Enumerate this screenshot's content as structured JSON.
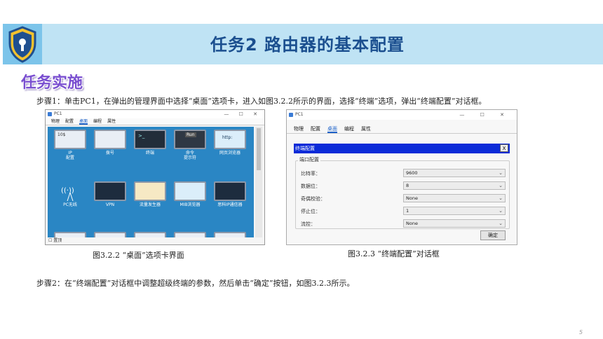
{
  "header": {
    "title": "任务2 路由器的基本配置"
  },
  "section": {
    "title": "任务实施"
  },
  "step1": "步骤1：单击PC1，在弹出的管理界面中选择“桌面”选项卡，进入如图3.2.2所示的界面，选择“终端”选项，弹出“终端配置”对话框。",
  "step2": "步骤2：在“终端配置”对话框中调整超级终端的参数，然后单击“确定”按钮，如图3.2.3所示。",
  "captions": {
    "fig1": "图3.2.2 “桌面”选项卡界面",
    "fig2": "图3.2.3 “终端配置”对话框"
  },
  "page_number": "5",
  "shot1": {
    "window_title": "PC1",
    "controls": "—  ☐  ✕",
    "tabs": [
      "物理",
      "配置",
      "桌面",
      "编程",
      "属性"
    ],
    "icons": [
      {
        "label": "IP\n配置",
        "badge": "10$"
      },
      {
        "label": "拨号",
        "badge": ""
      },
      {
        "label": "终端",
        "badge": ">_"
      },
      {
        "label": "命令\n提示符",
        "badge": "Run"
      },
      {
        "label": "网页浏览器",
        "badge": "http:"
      },
      {
        "label": "PC无线",
        "badge": ""
      },
      {
        "label": "VPN",
        "badge": ""
      },
      {
        "label": "流量发生器",
        "badge": ""
      },
      {
        "label": "MIB浏览器",
        "badge": ""
      },
      {
        "label": "思科IP通信器",
        "badge": ""
      }
    ],
    "checkbox_label": "置顶"
  },
  "shot2": {
    "window_title": "PC1",
    "controls": "—  ☐  ✕",
    "tabs": [
      "物理",
      "配置",
      "桌面",
      "编程",
      "属性"
    ],
    "dialog_title": "终端配置",
    "close": "X",
    "group_label": "端口配置",
    "fields": [
      {
        "label": "比特率：",
        "value": "9600"
      },
      {
        "label": "数据位：",
        "value": "8"
      },
      {
        "label": "奇偶校验：",
        "value": "None"
      },
      {
        "label": "停止位：",
        "value": "1"
      },
      {
        "label": "流控：",
        "value": "None"
      }
    ],
    "ok_label": "确定"
  },
  "colors": {
    "header_band": "#bfe3f4",
    "title_text": "#1b4f8f",
    "section_title": "#7a4fd0",
    "desktop_bg": "#2a86c4",
    "dialog_bar": "#0b2bd8"
  }
}
